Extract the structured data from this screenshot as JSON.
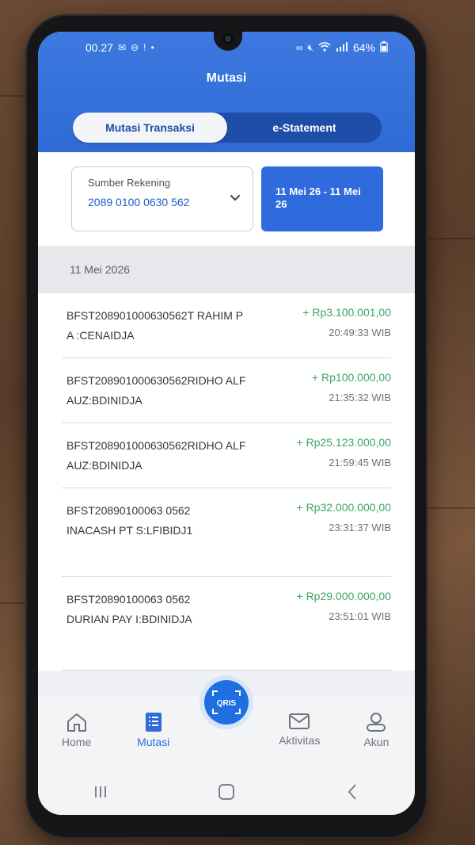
{
  "status": {
    "time": "00.27",
    "battery": "64%",
    "left_icons": [
      "mail-icon",
      "do-not-disturb-icon",
      "alert-icon",
      "dot-icon"
    ],
    "right_icons": [
      "vowifi-icon",
      "mute-icon",
      "wifi-icon",
      "signal-icon",
      "battery-icon"
    ]
  },
  "header": {
    "title": "Mutasi",
    "tabs": [
      {
        "label": "Mutasi Transaksi",
        "active": true
      },
      {
        "label": "e-Statement",
        "active": false
      }
    ]
  },
  "filters": {
    "source_label": "Sumber Rekening",
    "source_value": "2089 0100 0630 562",
    "date_range": "11 Mei 26 - 11 Mei 26"
  },
  "date_group": "11 Mei 2026",
  "transactions": [
    {
      "desc": "BFST208901000630562T RAHIM PA  :CENAIDJA",
      "amount": "+ Rp3.100.001,00",
      "time": "20:49:33 WIB"
    },
    {
      "desc": "BFST208901000630562RIDHO ALFAUZ:BDINIDJA",
      "amount": "+ Rp100.000,00",
      "time": "21:35:32 WIB"
    },
    {
      "desc": "BFST208901000630562RIDHO ALFAUZ:BDINIDJA",
      "amount": "+ Rp25.123.000,00",
      "time": "21:59:45 WIB"
    },
    {
      "desc": "BFST20890100063 0562INACASH PT S:LFIBIDJ1",
      "amount": "+ Rp32.000.000,00",
      "time": "23:31:37 WIB"
    },
    {
      "desc": "BFST20890100063 0562DURIAN PAY I:BDINIDJA",
      "amount": "+ Rp29.000.000,00",
      "time": "23:51:01 WIB"
    }
  ],
  "bottom_nav": [
    {
      "label": "Home",
      "icon": "home-icon",
      "active": false
    },
    {
      "label": "Mutasi",
      "icon": "document-list-icon",
      "active": true
    },
    {
      "label": "Aktivitas",
      "icon": "mail-icon",
      "active": false
    },
    {
      "label": "Akun",
      "icon": "user-icon",
      "active": false
    }
  ],
  "qris": {
    "label": "QRIS",
    "icon": "qris-scan-icon"
  },
  "colors": {
    "brand_blue": "#2f6bdc",
    "header_blue": "#3d79e0",
    "amount_green": "#3aa569"
  }
}
